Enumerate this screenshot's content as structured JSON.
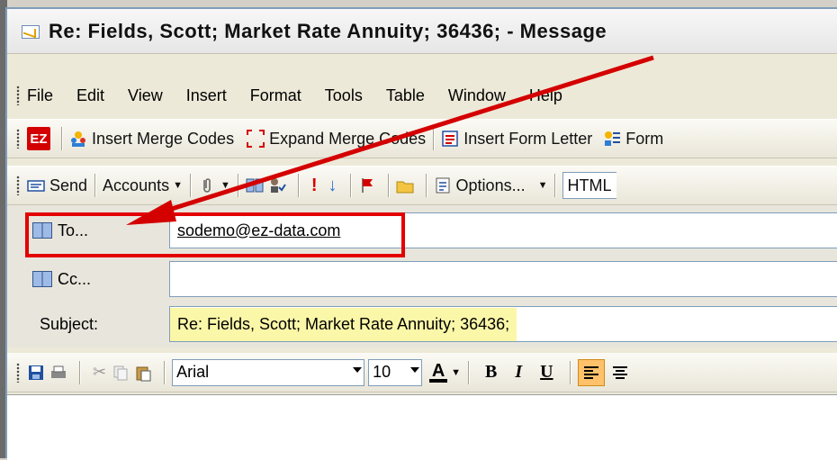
{
  "window": {
    "title": "Re: Fields, Scott; Market Rate Annuity; 36436; - Message"
  },
  "menu": [
    "File",
    "Edit",
    "View",
    "Insert",
    "Format",
    "Tools",
    "Table",
    "Window",
    "Help"
  ],
  "toolbar1": {
    "ez_label": "EZ",
    "insert_merge_codes": "Insert Merge Codes",
    "expand_merge_codes": "Expand Merge Codes",
    "insert_form_letter": "Insert Form Letter",
    "form": "Form"
  },
  "toolbar2": {
    "send": "Send",
    "accounts": "Accounts",
    "options": "Options...",
    "html": "HTML"
  },
  "headers": {
    "to_label": "To...",
    "to_value": "sodemo@ez-data.com",
    "cc_label": "Cc...",
    "cc_value": "",
    "subject_label": "Subject:",
    "subject_value": "Re: Fields, Scott; Market Rate Annuity; 36436;"
  },
  "format_toolbar": {
    "font": "Arial",
    "size": "10",
    "bold": "B",
    "italic": "I",
    "underline": "U"
  },
  "colors": {
    "highlight_box": "#e30000",
    "subject_highlight": "#fbf7a8",
    "arrow": "#d40000"
  }
}
